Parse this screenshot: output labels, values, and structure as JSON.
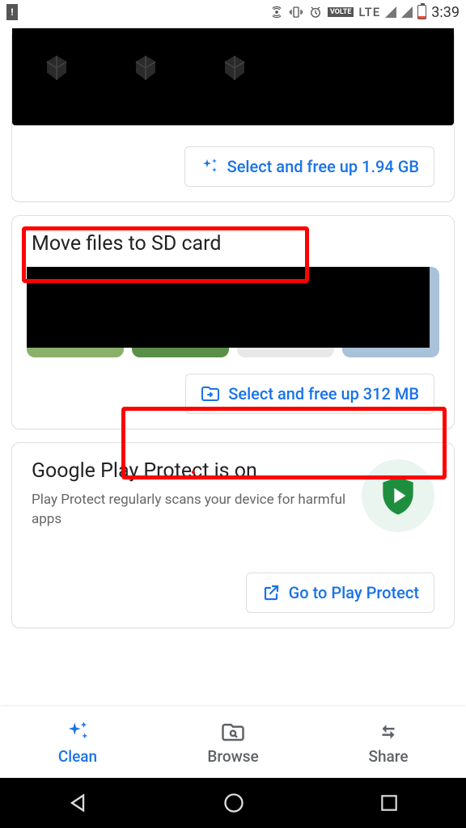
{
  "status": {
    "time": "3:39",
    "network": "LTE",
    "volte": "VOLTE"
  },
  "card_top": {
    "action": "Select and free up 1.94 GB"
  },
  "card_sd": {
    "title": "Move files to SD card",
    "action": "Select and free up 312 MB"
  },
  "card_protect": {
    "title": "Google Play Protect is on",
    "subtitle": "Play Protect regularly scans your device for harmful apps",
    "action": "Go to Play Protect"
  },
  "nav": {
    "clean": "Clean",
    "browse": "Browse",
    "share": "Share"
  }
}
